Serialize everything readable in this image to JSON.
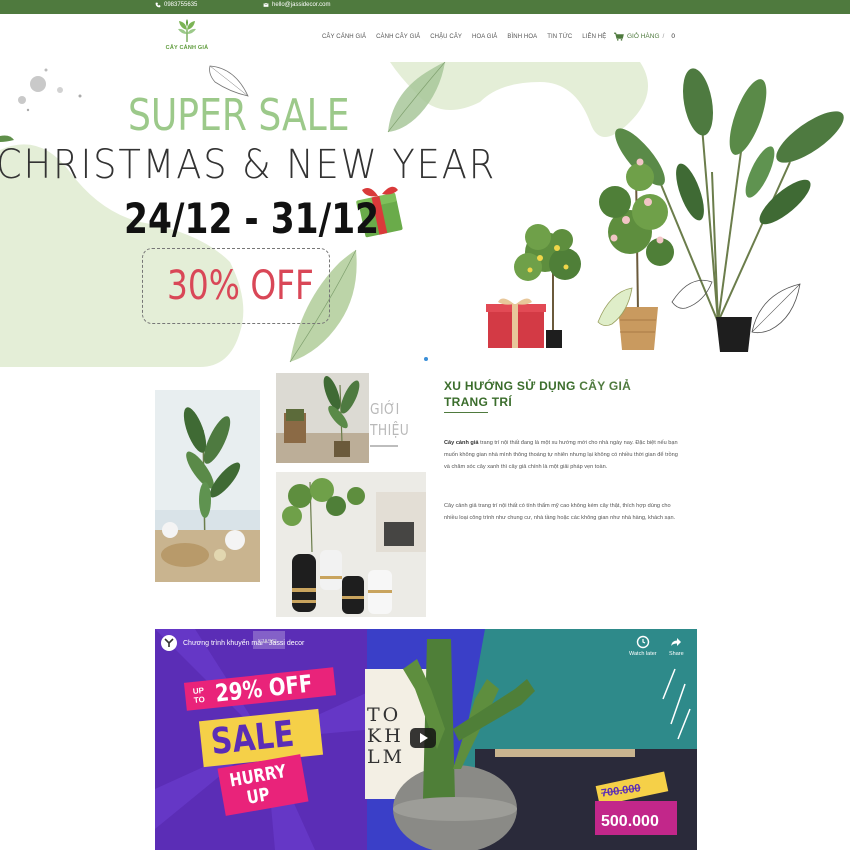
{
  "topbar": {
    "phone": "0983755635",
    "email": "hello@jassidecor.com"
  },
  "logo": {
    "text": "CÂY CẢNH GIẢ"
  },
  "nav": [
    "CÂY CẢNH GIẢ",
    "CÀNH CÂY GIẢ",
    "CHẬU CÂY",
    "HOA GIẢ",
    "BÌNH HOA",
    "TIN TỨC",
    "LIÊN HỆ"
  ],
  "cart": {
    "label": "GIỎ HÀNG",
    "sep": "/",
    "count": "0"
  },
  "hero": {
    "headline": "SUPER SALE",
    "subheadline": "CHRISTMAS & NEW YEAR",
    "dates": "24/12 - 31/12",
    "discount": "30% OFF"
  },
  "intro": {
    "side_label_1": "GIỚI",
    "side_label_2": "THIỆU",
    "title_part1": "XU HƯỚNG SỬ DỤNG ",
    "title_highlight": "CÂY GIẢ",
    "title_part2": "TRANG TRÍ",
    "para1_bold": "Cây cảnh giả",
    "para1_rest": " trang trí nội thất đang là một xu hướng mới cho nhà ngày nay. Đặc biệt nếu bạn muốn không gian nhà mình thông thoáng tự nhiên nhưng lại không có nhiều thời gian để trồng và chăm sóc cây xanh thì cây giả chính là một giải pháp vẹn toàn.",
    "para2": "Cây cảnh giả trang trí nội thất có tính thẩm mỹ cao không kém cây thật, thích hợp dùng cho nhiều loại công trình như chung cư, nhà tầng hoặc các không gian như nhà hàng, khách sạn.",
    "photo_caption": "TO KH LM"
  },
  "video": {
    "title": "Chương trình khuyến mãi - Jassi decor",
    "watch_later": "Watch later",
    "share": "Share",
    "brand": "JASSI",
    "promo_up_to": "UP TO",
    "promo_pct": "29% OFF",
    "promo_sale": "SALE",
    "promo_hurry1": "HURRY",
    "promo_hurry2": "UP",
    "old_price": "700.000",
    "new_price": "500.000",
    "sign_text": "TO\nKH\nLM"
  },
  "colors": {
    "brand_green": "#4f7a3e",
    "accent_red": "#d94757",
    "sale_green": "#9cc98a",
    "video_purple": "#5b2db6"
  }
}
